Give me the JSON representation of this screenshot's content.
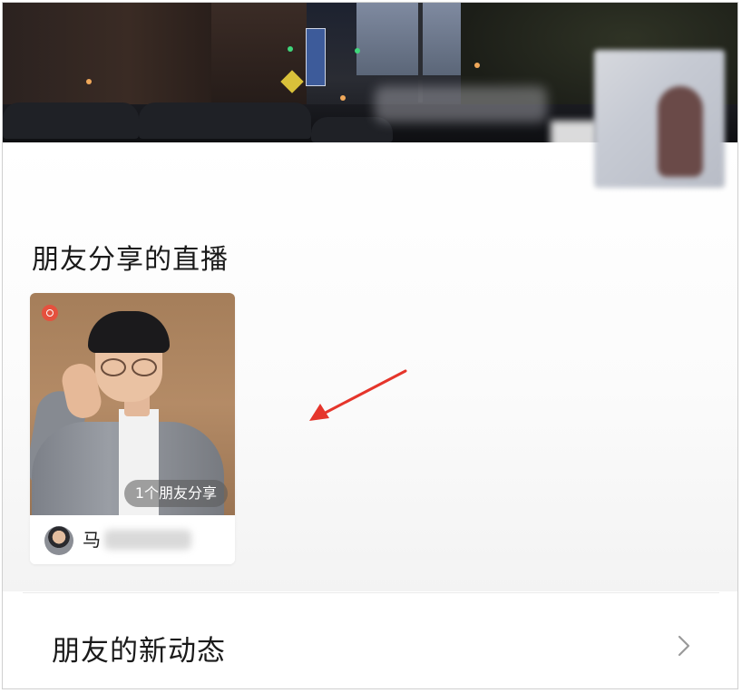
{
  "section": {
    "title": "朋友分享的直播"
  },
  "live_card": {
    "badge": "1个朋友分享",
    "host_name_visible": "马",
    "live_indicator_color": "#e5513e"
  },
  "nav": {
    "friends_updates_label": "朋友的新动态",
    "chevron": "chevron-right-icon"
  },
  "annotation": {
    "arrow_color": "#e5352b"
  }
}
